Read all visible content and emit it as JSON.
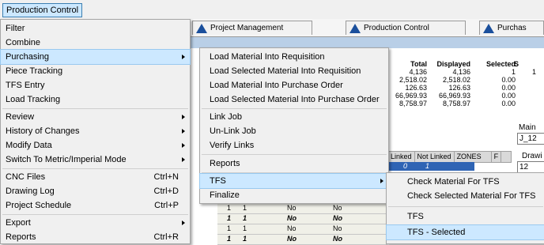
{
  "menubar": {
    "title": "Production Control"
  },
  "tabs": [
    {
      "label": "Project Management",
      "color": "#1a4f9c"
    },
    {
      "label": "Production Control",
      "color": "#1a4f9c"
    },
    {
      "label": "Purchas",
      "color": "#1a4f9c"
    }
  ],
  "main_menu": {
    "items": [
      {
        "label": "Filter",
        "shortcut": "",
        "has_submenu": false
      },
      {
        "label": "Combine",
        "shortcut": "",
        "has_submenu": false
      },
      {
        "label": "Purchasing",
        "shortcut": "",
        "has_submenu": true,
        "highlighted": true
      },
      {
        "label": "Piece Tracking",
        "shortcut": "",
        "has_submenu": false
      },
      {
        "label": "TFS Entry",
        "shortcut": "",
        "has_submenu": false
      },
      {
        "label": "Load Tracking",
        "shortcut": "",
        "has_submenu": false
      },
      {
        "label": "Review",
        "shortcut": "",
        "has_submenu": true
      },
      {
        "label": "History of Changes",
        "shortcut": "",
        "has_submenu": true
      },
      {
        "label": "Modify Data",
        "shortcut": "",
        "has_submenu": true
      },
      {
        "label": "Switch To Metric/Imperial Mode",
        "shortcut": "",
        "has_submenu": true
      },
      {
        "label": "CNC Files",
        "shortcut": "Ctrl+N",
        "has_submenu": false
      },
      {
        "label": "Drawing Log",
        "shortcut": "Ctrl+D",
        "has_submenu": false
      },
      {
        "label": "Project Schedule",
        "shortcut": "Ctrl+P",
        "has_submenu": false
      },
      {
        "label": "Export",
        "shortcut": "",
        "has_submenu": true
      },
      {
        "label": "Reports",
        "shortcut": "Ctrl+R",
        "has_submenu": false
      }
    ]
  },
  "purchasing_menu": {
    "items": [
      {
        "label": "Load Material Into Requisition",
        "has_submenu": false
      },
      {
        "label": "Load Selected Material Into Requisition",
        "has_submenu": false
      },
      {
        "label": "Load Material Into Purchase Order",
        "has_submenu": false
      },
      {
        "label": "Load Selected Material Into Purchase Order",
        "has_submenu": false
      },
      {
        "label": "Link Job",
        "has_submenu": false
      },
      {
        "label": "Un-Link Job",
        "has_submenu": false
      },
      {
        "label": "Verify Links",
        "has_submenu": false
      },
      {
        "label": "Reports",
        "has_submenu": false
      },
      {
        "label": "TFS",
        "has_submenu": true,
        "highlighted": true
      },
      {
        "label": "Finalize",
        "has_submenu": false
      }
    ]
  },
  "tfs_menu": {
    "items": [
      {
        "label": "Check Material For TFS"
      },
      {
        "label": "Check Selected Material For TFS"
      },
      {
        "label": "TFS"
      },
      {
        "label": "TFS - Selected",
        "highlighted": true
      }
    ]
  },
  "stats": {
    "headers": [
      "Total",
      "Displayed",
      "Selected",
      "S"
    ],
    "rows": [
      [
        "4,136",
        "4,136",
        "1",
        "1"
      ],
      [
        "2,518.02",
        "2,518.02",
        "0.00",
        ""
      ],
      [
        "126.63",
        "126.63",
        "0.00",
        ""
      ],
      [
        "66,969.93",
        "66,969.93",
        "0.00",
        ""
      ],
      [
        "8,758.97",
        "8,758.97",
        "0.00",
        ""
      ]
    ]
  },
  "side": {
    "main_label": "Main M",
    "main_value": "J_12",
    "drawing_label": "Drawi",
    "drawing_value": "12"
  },
  "grid": {
    "headers": [
      "Linked",
      "Not Linked",
      "ZONES",
      "F"
    ],
    "selected_row": [
      "0",
      "1"
    ],
    "rows": [
      [
        "1",
        "1",
        "No",
        "No"
      ],
      [
        "1",
        "1",
        "No",
        "No"
      ],
      [
        "1",
        "1",
        "No",
        "No"
      ],
      [
        "1",
        "1",
        "No",
        "No"
      ]
    ]
  },
  "colors": {
    "highlight": "#cce8ff",
    "menu_bg": "#f0f0f0",
    "selection": "#2f64b4"
  }
}
